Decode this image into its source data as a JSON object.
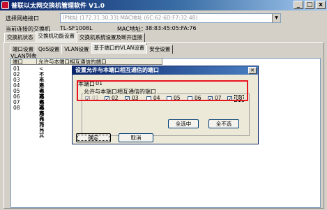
{
  "window": {
    "title": "普联以太网交换机管理软件 V1.0",
    "controls": [
      "_",
      "□",
      "x"
    ]
  },
  "nic": {
    "label": "选择网络接口",
    "value": "IP地址 (172.31.30.33)    MAC地址 (6C:62:6D:F7:32:48)"
  },
  "switch_info": {
    "label": "当前连接的交换机",
    "model": "TL-SF1008L",
    "mac_label": "MAC地址：",
    "mac_value": "38:83:45:05:FA:76"
  },
  "main_tabs": [
    {
      "label": "交换机状态",
      "active": false
    },
    {
      "label": "交换机功能设置",
      "active": true
    },
    {
      "label": "交换机系统设置及断开连接",
      "active": false
    }
  ],
  "sub_tabs": [
    {
      "label": "端口设置",
      "active": false
    },
    {
      "label": "QoS设置",
      "active": false
    },
    {
      "label": "VLAN设置",
      "active": false
    },
    {
      "label": "基于端口的VLAN设置",
      "active": true
    },
    {
      "label": "安全设置",
      "active": false
    }
  ],
  "vlan_list": {
    "title": "VLAN列表",
    "columns": [
      "端口",
      "允许与本端口相互通信的端口"
    ],
    "rows": [
      {
        "port": "01",
        "allowed": "<不允许与其"
      },
      {
        "port": "02",
        "allowed": "<不允许与其"
      },
      {
        "port": "03",
        "allowed": "<不允许与其"
      },
      {
        "port": "04",
        "allowed": "<不允许与其"
      },
      {
        "port": "05",
        "allowed": "<不允许与其"
      },
      {
        "port": "06",
        "allowed": "<不允许与其"
      },
      {
        "port": "07",
        "allowed": "<不允许与其"
      },
      {
        "port": "08",
        "allowed": "<不允许与其"
      }
    ]
  },
  "dialog": {
    "title": "设置允许与本端口相互通信的端口",
    "this_port_label": "本端口",
    "this_port_value": "01",
    "group_label": "允许与本端口相互通信的端口",
    "ports": [
      {
        "label": "01",
        "checked": true,
        "enabled": false
      },
      {
        "label": "02",
        "checked": true,
        "enabled": true
      },
      {
        "label": "03",
        "checked": true,
        "enabled": true
      },
      {
        "label": "04",
        "checked": false,
        "enabled": true
      },
      {
        "label": "05",
        "checked": false,
        "enabled": true
      },
      {
        "label": "06",
        "checked": false,
        "enabled": true
      },
      {
        "label": "07",
        "checked": true,
        "enabled": true
      },
      {
        "label": "08",
        "checked": true,
        "enabled": true
      }
    ],
    "select_all_label": "全选中",
    "deselect_all_label": "全不选",
    "ok_label": "确定",
    "cancel_label": "取消"
  }
}
